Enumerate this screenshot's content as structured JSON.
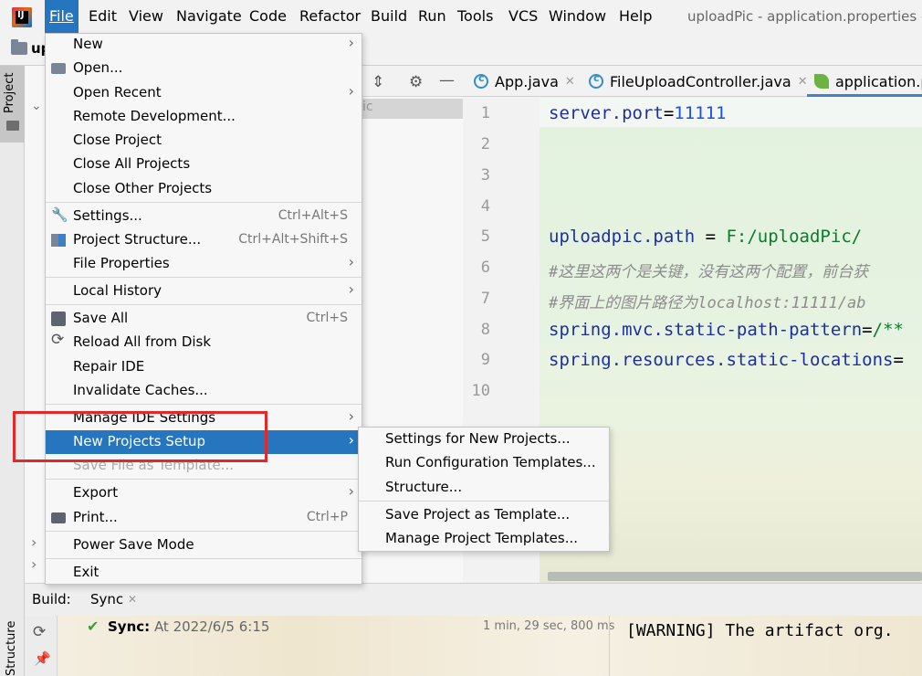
{
  "window": {
    "title": "uploadPic - application.properties -"
  },
  "menubar": {
    "items": [
      "File",
      "Edit",
      "View",
      "Navigate",
      "Code",
      "Refactor",
      "Build",
      "Run",
      "Tools",
      "VCS",
      "Window",
      "Help"
    ]
  },
  "navbar": {
    "project": "up"
  },
  "left_stripe": {
    "project_label": "Project",
    "structure_label": "Structure"
  },
  "project_panel": {
    "selected_text": "ic"
  },
  "editor": {
    "tabs": [
      {
        "label": "App.java"
      },
      {
        "label": "FileUploadController.java"
      },
      {
        "label": "application.p"
      }
    ],
    "line_numbers": [
      "1",
      "2",
      "3",
      "4",
      "5",
      "6",
      "7",
      "8",
      "9",
      "10"
    ],
    "lines": {
      "l1_key": "server.port",
      "l1_eq": "=",
      "l1_val": "11111",
      "l5_key": "uploadpic.path",
      "l5_eq": " = ",
      "l5_val": "F:/uploadPic/",
      "l6": "#这里这两个是关键，没有这两个配置，前台获",
      "l7": "#界面上的图片路径为localhost:11111/ab",
      "l8_key": "spring.mvc.static-path-pattern",
      "l8_eq": "=",
      "l8_val": "/**",
      "l9_key": "spring.resources.static-locations",
      "l9_eq": "="
    }
  },
  "file_menu": {
    "new": "New",
    "open": "Open...",
    "open_recent": "Open Recent",
    "remote_dev": "Remote Development...",
    "close_project": "Close Project",
    "close_all": "Close All Projects",
    "close_other": "Close Other Projects",
    "settings": "Settings...",
    "settings_sc": "Ctrl+Alt+S",
    "project_structure": "Project Structure...",
    "project_structure_sc": "Ctrl+Alt+Shift+S",
    "file_properties": "File Properties",
    "local_history": "Local History",
    "save_all": "Save All",
    "save_all_sc": "Ctrl+S",
    "reload": "Reload All from Disk",
    "repair": "Repair IDE",
    "invalidate": "Invalidate Caches...",
    "manage_ide": "Manage IDE Settings",
    "new_projects_setup": "New Projects Setup",
    "save_template": "Save File as Template...",
    "export": "Export",
    "print": "Print...",
    "print_sc": "Ctrl+P",
    "power_save": "Power Save Mode",
    "exit": "Exit"
  },
  "submenu": {
    "items": [
      "Settings for New Projects...",
      "Run Configuration Templates...",
      "Structure...",
      "Save Project as Template...",
      "Manage Project Templates..."
    ]
  },
  "build": {
    "label": "Build:",
    "tab": "Sync",
    "status_bold": "Sync:",
    "status_time": "At 2022/6/5 6:15",
    "duration": "1 min, 29 sec, 800 ms",
    "console": "[WARNING] The artifact org."
  },
  "colors": {
    "accent": "#2675bf",
    "highlight_box": "#e02a2a"
  }
}
